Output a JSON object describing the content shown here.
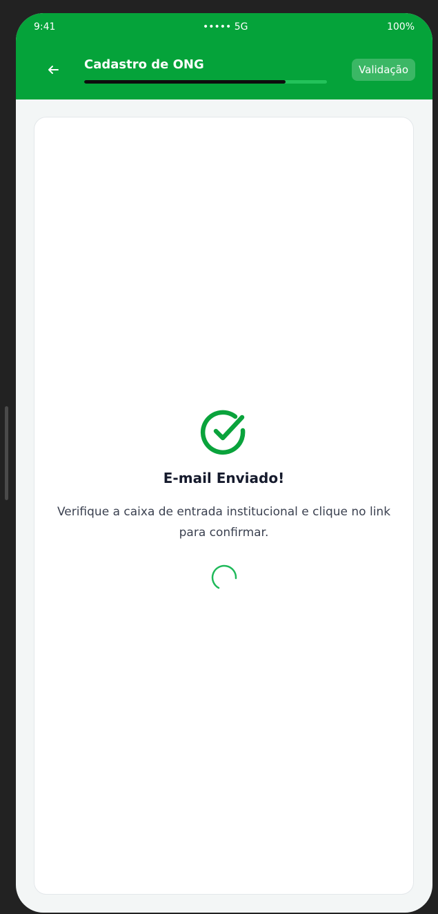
{
  "status_bar": {
    "time": "9:41",
    "signal": "••••• 5G",
    "battery": "100%"
  },
  "header": {
    "back_icon": "arrow-left-icon",
    "title": "Cadastro de ONG",
    "step_badge": "Validação",
    "progress": 0.83,
    "background_color": "#05a33a"
  },
  "confirmation": {
    "icon": "check-circle-icon",
    "title": "E-mail Enviado!",
    "message": "Verifique a caixa de entrada institucional e clique no link para confirmar.",
    "loading_icon": "spinner-icon",
    "accent_color": "#0aa33c"
  }
}
